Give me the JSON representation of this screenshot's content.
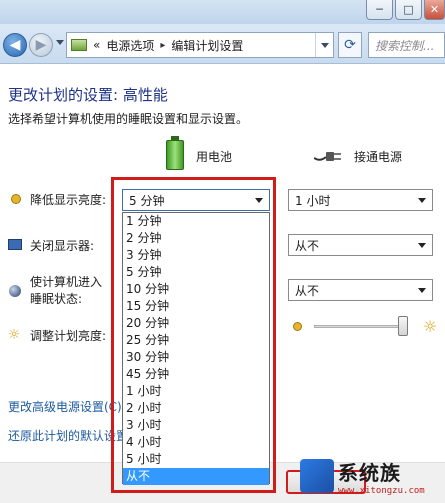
{
  "window": {
    "minimize_glyph": "─",
    "maximize_glyph": "□",
    "close_glyph": "✕"
  },
  "nav": {
    "breadcrumb_prefix": "«",
    "breadcrumb": [
      "电源选项",
      "编辑计划设置"
    ],
    "breadcrumb_sep": "▸",
    "search_placeholder": "搜索控制..."
  },
  "header": {
    "title": "更改计划的设置: 高性能",
    "description": "选择希望计算机使用的睡眠设置和显示设置。"
  },
  "columns": {
    "battery": "用电池",
    "plugged_in": "接通电源"
  },
  "settings": [
    {
      "label": "降低显示亮度:",
      "battery": "5 分钟",
      "plugged": "1 小时"
    },
    {
      "label": "关闭显示器:",
      "battery": "",
      "plugged": "从不"
    },
    {
      "label_line1": "使计算机进入",
      "label_line2": "睡眠状态:",
      "battery": "",
      "plugged": "从不"
    },
    {
      "label": "调整计划亮度:"
    }
  ],
  "brightness_plugged_level": 0.95,
  "dropdown": {
    "items": [
      "1 分钟",
      "2 分钟",
      "3 分钟",
      "5 分钟",
      "10 分钟",
      "15 分钟",
      "20 分钟",
      "25 分钟",
      "30 分钟",
      "45 分钟",
      "1 小时",
      "2 小时",
      "3 小时",
      "4 小时",
      "5 小时",
      "从不"
    ],
    "selected": "从不"
  },
  "links": {
    "advanced": "更改高级电源设置(C)",
    "restore": "还原此计划的默认设置"
  },
  "watermark": {
    "name": "系统族",
    "url": "www.xitongzu.com"
  },
  "colors": {
    "accent_title": "#1e3287",
    "link": "#1e5aa0",
    "selection": "#3399ff",
    "highlight_frame": "#d11c1c"
  }
}
